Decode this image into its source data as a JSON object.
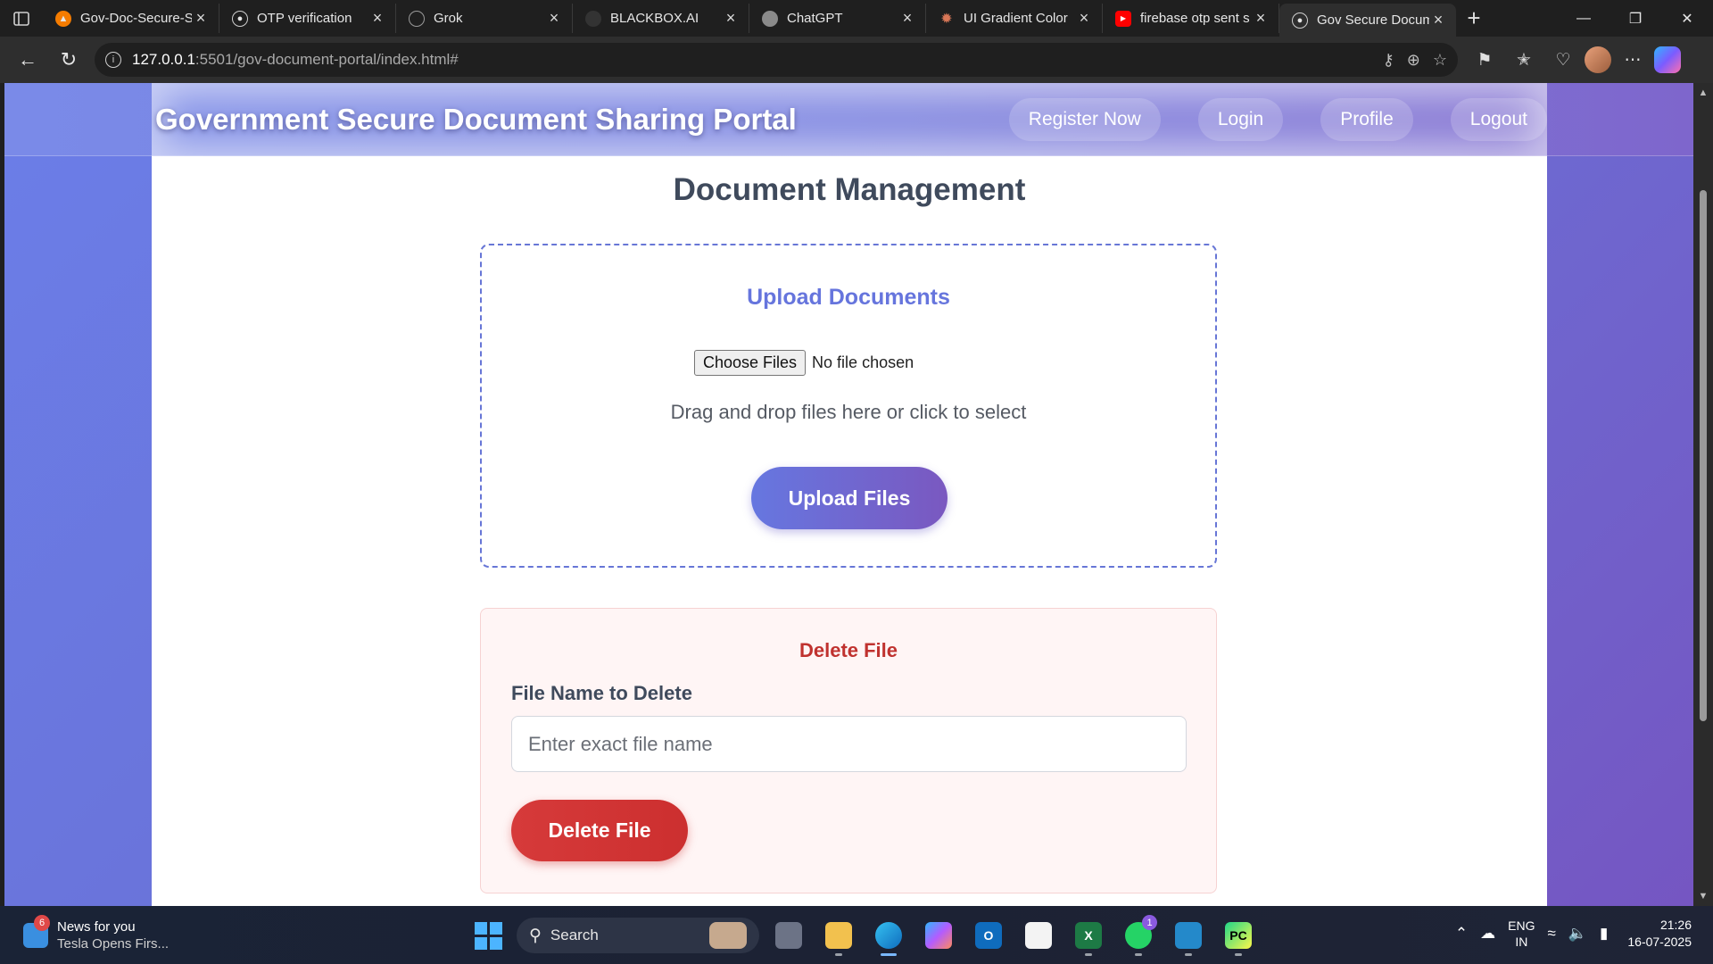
{
  "browser": {
    "tabs": [
      {
        "title": "Gov-Doc-Secure-S",
        "icon": "firebase-icon",
        "color": "#f57c00",
        "active": false
      },
      {
        "title": "OTP verification",
        "icon": "globe-icon",
        "color": "#cfcfcf",
        "active": false
      },
      {
        "title": "Grok",
        "icon": "grok-icon",
        "color": "#9a9a9a",
        "active": false
      },
      {
        "title": "BLACKBOX.AI",
        "icon": "blackbox-icon",
        "color": "#333333",
        "active": false
      },
      {
        "title": "ChatGPT",
        "icon": "chatgpt-icon",
        "color": "#8a8a8a",
        "active": false
      },
      {
        "title": "UI Gradient Color",
        "icon": "claude-icon",
        "color": "#d97757",
        "active": false
      },
      {
        "title": "firebase otp sent s",
        "icon": "youtube-icon",
        "color": "#ff0000",
        "active": false
      },
      {
        "title": "Gov Secure Docum",
        "icon": "globe-icon",
        "color": "#cfcfcf",
        "active": true
      }
    ],
    "url_host": "127.0.0.1",
    "url_path": ":5501/gov-document-portal/index.html#"
  },
  "site": {
    "title": "Government Secure Document Sharing Portal",
    "nav": [
      "Register Now",
      "Login",
      "Profile",
      "Logout"
    ]
  },
  "page": {
    "heading": "Document Management",
    "upload": {
      "heading": "Upload Documents",
      "choose_label": "Choose Files",
      "no_file": "No file chosen",
      "hint": "Drag and drop files here or click to select",
      "button": "Upload Files"
    },
    "delete": {
      "heading": "Delete File",
      "label": "File Name to Delete",
      "placeholder": "Enter exact file name",
      "button": "Delete File"
    }
  },
  "taskbar": {
    "news_title": "News for you",
    "news_sub": "Tesla Opens Firs...",
    "news_badge": "6",
    "search_label": "Search",
    "whatsapp_badge": "1",
    "lang_top": "ENG",
    "lang_bottom": "IN",
    "time": "21:26",
    "date": "16-07-2025"
  },
  "colors": {
    "accent": "#6675dd",
    "danger": "#c0322f",
    "page_gradient_start": "#6b7ee8",
    "page_gradient_end": "#7556c2"
  }
}
